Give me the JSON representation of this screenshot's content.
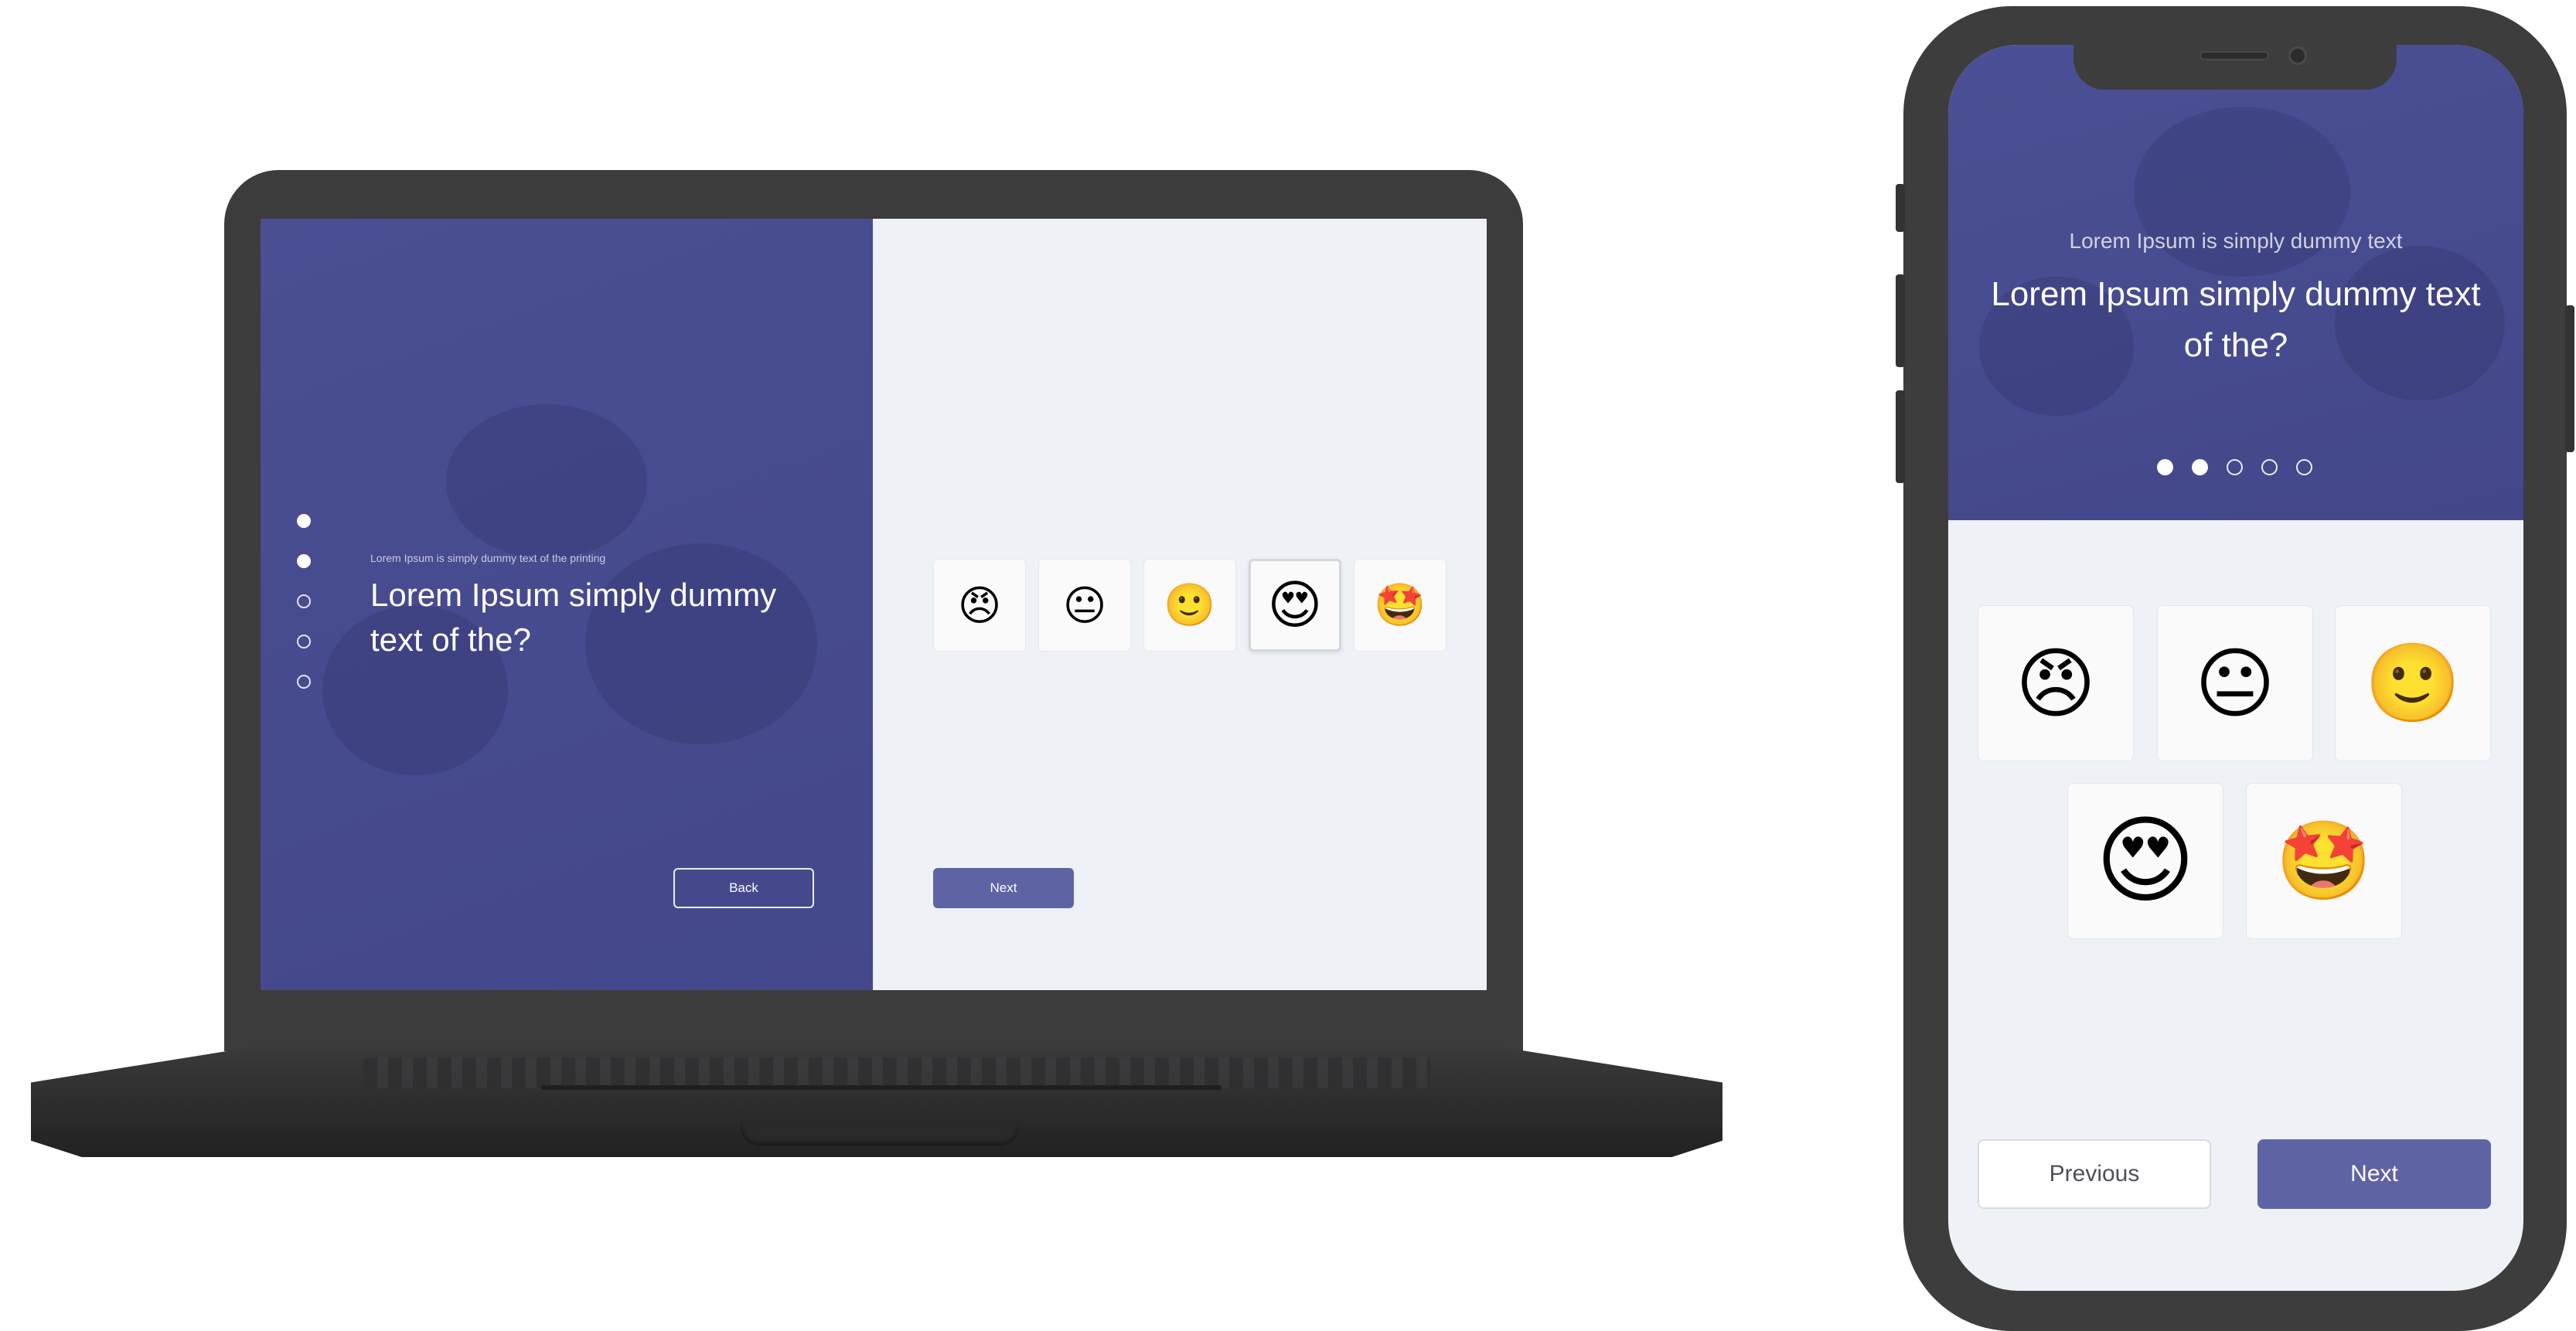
{
  "laptop": {
    "kicker": "Lorem Ipsum is simply dummy text of the printing",
    "question": "Lorem Ipsum simply dummy text of the?",
    "progress": {
      "total": 5,
      "completed": 2
    },
    "back_label": "Back",
    "next_label": "Next",
    "emoji_options": [
      {
        "icon": "angry-face-icon",
        "glyph": "😠",
        "selected": false
      },
      {
        "icon": "neutral-face-icon",
        "glyph": "😐",
        "selected": false
      },
      {
        "icon": "slightly-smiling-face-icon",
        "glyph": "🙂",
        "selected": false
      },
      {
        "icon": "heart-eyes-face-icon",
        "glyph": "😍",
        "selected": true
      },
      {
        "icon": "star-struck-face-icon",
        "glyph": "🤩",
        "selected": false
      }
    ]
  },
  "phone": {
    "kicker": "Lorem Ipsum is simply dummy text",
    "question": "Lorem Ipsum simply dummy text of the?",
    "progress": {
      "total": 5,
      "completed": 2
    },
    "previous_label": "Previous",
    "next_label": "Next",
    "emoji_options": [
      {
        "icon": "angry-face-icon",
        "glyph": "😠",
        "selected": false
      },
      {
        "icon": "neutral-face-icon",
        "glyph": "😐",
        "selected": false
      },
      {
        "icon": "slightly-smiling-face-icon",
        "glyph": "🙂",
        "selected": false
      },
      {
        "icon": "heart-eyes-face-icon",
        "glyph": "😍",
        "selected": true
      },
      {
        "icon": "star-struck-face-icon",
        "glyph": "🤩",
        "selected": false
      }
    ]
  },
  "colors": {
    "accent": "#5e63a4",
    "header_bg": "#474b8f",
    "content_bg": "#eef1f6",
    "device_frame": "#3d3d3e"
  }
}
